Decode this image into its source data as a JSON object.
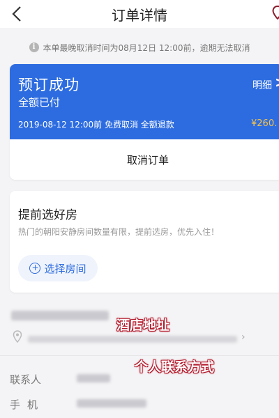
{
  "header": {
    "title": "订单详情",
    "back_icon": "chevron-left-icon",
    "share_icon": "map-pin-icon"
  },
  "notice": {
    "text": "本单最晚取消时间为08月12日 12:00前，逾期无法取消",
    "icon": "info-icon"
  },
  "order": {
    "status": "预订成功",
    "payment": "全额已付",
    "detail_label": "明细",
    "detail_arrow": ">",
    "policy": "2019-08-12 12:00前 免费取消 全额退款",
    "price": "¥260.",
    "cancel_label": "取消订单",
    "colors": {
      "banner": "#2d6ce0",
      "price": "#f5c24b"
    }
  },
  "room_select": {
    "title": "提前选好房",
    "description": "热门的朝阳安静房间数量有限，提前选房，优先入住！",
    "button_label": "选择房间",
    "button_icon": "plus-circle-icon"
  },
  "hotel": {
    "pin_icon": "location-pin-icon",
    "arrow": "›"
  },
  "annotations": {
    "address": "酒店地址",
    "contact": "个人联系方式"
  },
  "contact": {
    "name_label": "联系人",
    "phone_label": "手机"
  }
}
